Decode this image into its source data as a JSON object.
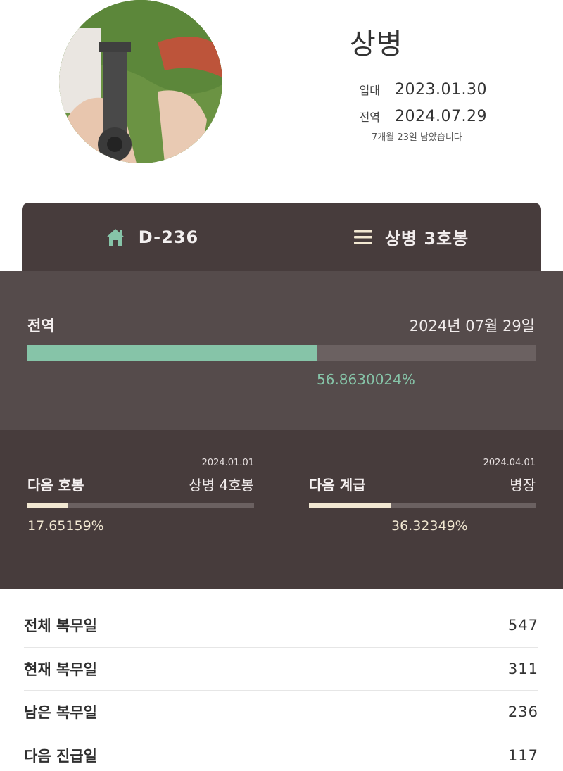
{
  "profile": {
    "rank": "상병",
    "enlist_label": "입대",
    "enlist_date": "2023.01.30",
    "discharge_label": "전역",
    "discharge_date": "2024.07.29",
    "remaining_text": "7개월 23일 남았습니다"
  },
  "tabs": {
    "d_day": {
      "label": "D-236",
      "icon": "home-icon"
    },
    "rank_step": {
      "label": "상병 3호봉",
      "icon": "menu-icon"
    }
  },
  "discharge": {
    "title": "전역",
    "date": "2024년 07월 29일",
    "percent_text": "56.8630024%",
    "percent": 56.8630024
  },
  "next_step": {
    "title": "다음 호봉",
    "date": "2024.01.01",
    "target": "상병 4호봉",
    "percent_text": "17.65159%",
    "percent": 17.65159
  },
  "next_rank": {
    "title": "다음 계급",
    "date": "2024.04.01",
    "target": "병장",
    "percent_text": "36.32349%",
    "percent": 36.32349
  },
  "stats": [
    {
      "label": "전체 복무일",
      "value": "547"
    },
    {
      "label": "현재 복무일",
      "value": "311"
    },
    {
      "label": "남은 복무일",
      "value": "236"
    },
    {
      "label": "다음 진급일",
      "value": "117"
    }
  ],
  "colors": {
    "accent_green": "#86c4a8",
    "accent_cream": "#f2e8d2",
    "panel_dark": "#473c3c",
    "panel_mid": "#554b4b"
  }
}
